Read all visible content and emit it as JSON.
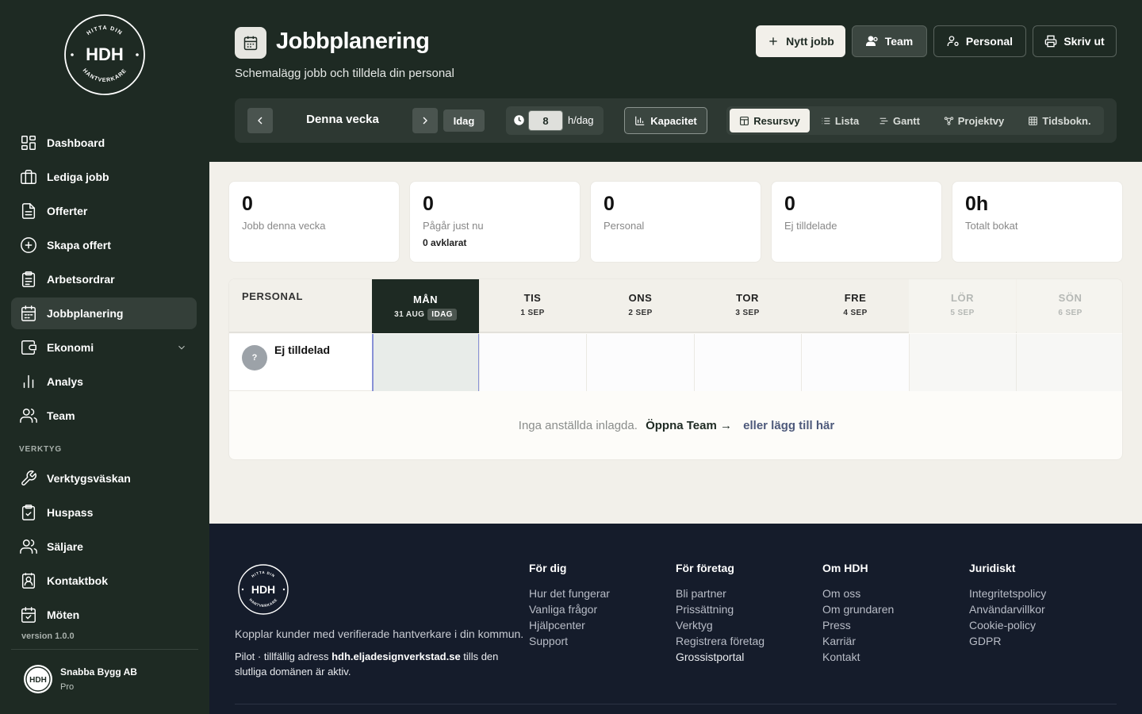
{
  "brand": {
    "logo_text": "HDH",
    "logo_ring_top": "HITTA DIN",
    "logo_ring_bottom": "HANTVERKARE"
  },
  "sidebar": {
    "items": [
      {
        "label": "Dashboard",
        "icon": "dashboard-icon"
      },
      {
        "label": "Lediga jobb",
        "icon": "briefcase-icon"
      },
      {
        "label": "Offerter",
        "icon": "document-icon"
      },
      {
        "label": "Skapa offert",
        "icon": "plus-circle-icon"
      },
      {
        "label": "Arbetsordrar",
        "icon": "clipboard-list-icon"
      },
      {
        "label": "Jobbplanering",
        "icon": "calendar-icon",
        "active": true
      },
      {
        "label": "Ekonomi",
        "icon": "wallet-icon",
        "expandable": true
      },
      {
        "label": "Analys",
        "icon": "bar-chart-icon"
      },
      {
        "label": "Team",
        "icon": "users-icon"
      }
    ],
    "section_tools": "VERKTYG",
    "tools": [
      {
        "label": "Verktygsväskan",
        "icon": "wrench-icon"
      },
      {
        "label": "Huspass",
        "icon": "clipboard-check-icon"
      },
      {
        "label": "Säljare",
        "icon": "users-icon"
      },
      {
        "label": "Kontaktbok",
        "icon": "contact-book-icon"
      },
      {
        "label": "Möten",
        "icon": "calendar-check-icon"
      }
    ],
    "version": "version 1.0.0",
    "account": {
      "company": "Snabba Bygg AB",
      "plan": "Pro"
    }
  },
  "header": {
    "title": "Jobbplanering",
    "subtitle": "Schemalägg jobb och tilldela din personal",
    "buttons": {
      "new_job": "Nytt jobb",
      "team": "Team",
      "personal": "Personal",
      "print": "Skriv ut"
    }
  },
  "toolbar": {
    "week_label": "Denna vecka",
    "today": "Idag",
    "hours_value": "8",
    "hours_unit": "h/dag",
    "capacity": "Kapacitet",
    "views": {
      "resource": "Resursvy",
      "list": "Lista",
      "gantt": "Gantt",
      "project": "Projektvy",
      "time": "Tidsbokn."
    }
  },
  "stats": [
    {
      "value": "0",
      "label": "Jobb denna vecka"
    },
    {
      "value": "0",
      "label": "Pågår just nu",
      "sub": "0 avklarat"
    },
    {
      "value": "0",
      "label": "Personal"
    },
    {
      "value": "0",
      "label": "Ej tilldelade"
    },
    {
      "value": "0h",
      "label": "Totalt bokat"
    }
  ],
  "schedule": {
    "personal_header": "PERSONAL",
    "today_badge": "IDAG",
    "days": [
      {
        "name": "MÅN",
        "date": "31 AUG"
      },
      {
        "name": "TIS",
        "date": "1 SEP"
      },
      {
        "name": "ONS",
        "date": "2 SEP"
      },
      {
        "name": "TOR",
        "date": "3 SEP"
      },
      {
        "name": "FRE",
        "date": "4 SEP"
      },
      {
        "name": "LÖR",
        "date": "5 SEP"
      },
      {
        "name": "SÖN",
        "date": "6 SEP"
      }
    ],
    "unassigned_avatar": "?",
    "unassigned_label": "Ej tilldelad",
    "empty_text": "Inga anställda inlagda.",
    "open_team": "Öppna Team →",
    "add_here": "eller lägg till här"
  },
  "footer": {
    "tagline": "Kopplar kunder med verifierade hantverkare i din kommun.",
    "pilot_prefix": "Pilot · tillfällig adress ",
    "pilot_domain": "hdh.eljadesignverkstad.se",
    "pilot_suffix": " tills den slutliga domänen är aktiv.",
    "columns": [
      {
        "title": "För dig",
        "links": [
          "Hur det fungerar",
          "Vanliga frågor",
          "Hjälpcenter",
          "Support"
        ]
      },
      {
        "title": "För företag",
        "links": [
          "Bli partner",
          "Prissättning",
          "Verktyg",
          "Registrera företag",
          "Grossistportal"
        ]
      },
      {
        "title": "Om HDH",
        "links": [
          "Om oss",
          "Om grundaren",
          "Press",
          "Karriär",
          "Kontakt"
        ]
      },
      {
        "title": "Juridiskt",
        "links": [
          "Integritetspolicy",
          "Användarvillkor",
          "Cookie-policy",
          "GDPR"
        ]
      }
    ]
  }
}
